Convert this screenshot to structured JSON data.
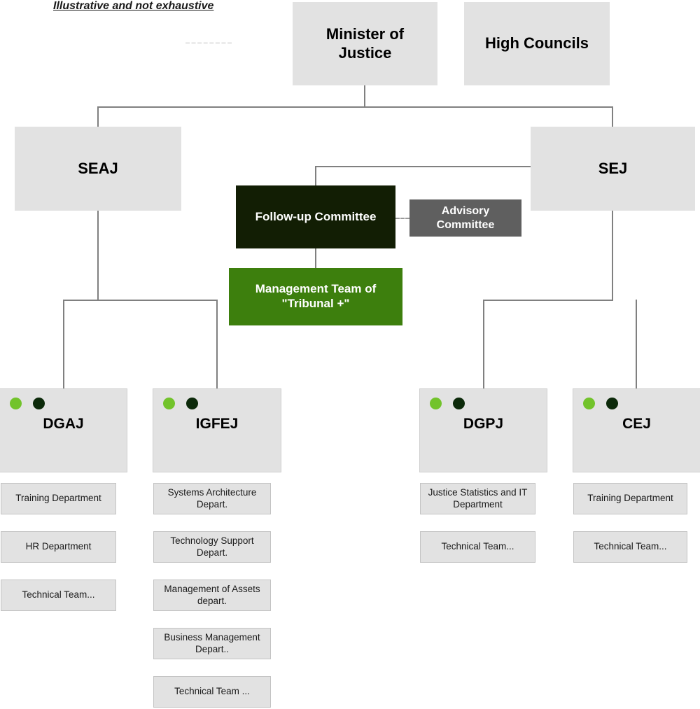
{
  "header": {
    "note": "Illustrative and not exhaustive"
  },
  "colors": {
    "box_grey": "#E2E2E2",
    "box_dark_green": "#121E04",
    "box_green": "#3D7F0D",
    "box_mid_grey": "#5F5F5F",
    "dot_light_green": "#72C32B",
    "dot_dark_green": "#0C2A0A",
    "connector_grey": "#808080"
  },
  "top_level": {
    "minister": "Minister of Justice",
    "high_councils": "High Councils"
  },
  "second_level": {
    "seaj": "SEAJ",
    "sej": "SEJ"
  },
  "program": {
    "follow_up_committee": "Follow-up Committee",
    "advisory_committee": "Advisory Committee",
    "management_team": "Management Team of \"Tribunal +\""
  },
  "units": [
    {
      "code": "DGAJ",
      "departments": [
        "Training Department",
        "HR Department",
        "Technical Team..."
      ]
    },
    {
      "code": "IGFEJ",
      "departments": [
        "Systems Architecture Depart.",
        "Technology Support Depart.",
        "Management of Assets depart.",
        "Business Management Depart..",
        "Technical Team ..."
      ]
    },
    {
      "code": "DGPJ",
      "departments": [
        "Justice Statistics and IT Department",
        "Technical Team..."
      ]
    },
    {
      "code": "CEJ",
      "departments": [
        "Training Department",
        "Technical Team..."
      ]
    }
  ]
}
